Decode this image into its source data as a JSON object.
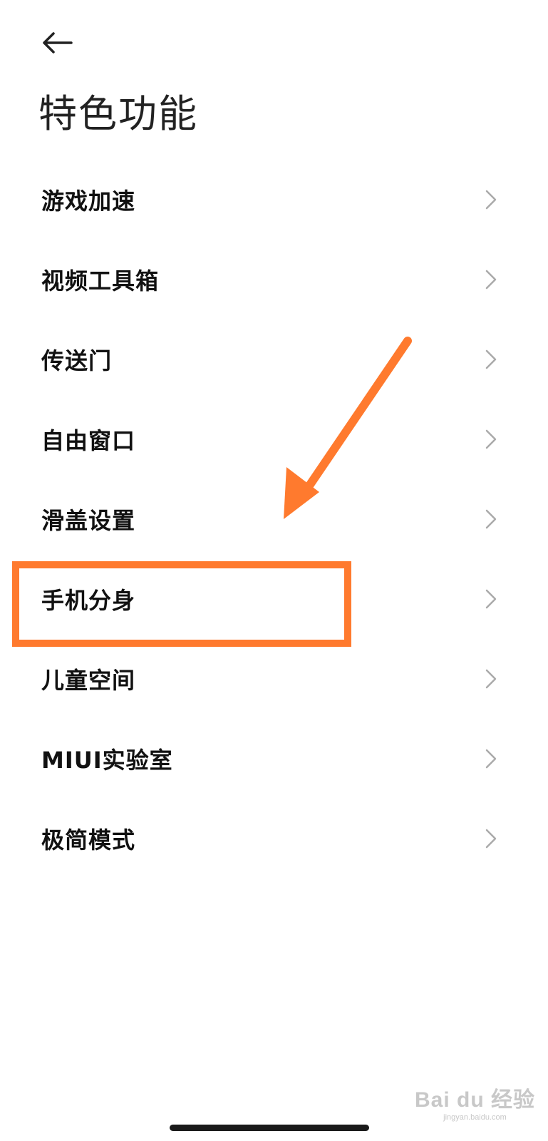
{
  "header": {
    "back_icon": "arrow-left-icon",
    "title": "特色功能"
  },
  "menu": {
    "items": [
      {
        "label": "游戏加速",
        "icon": "chevron-right-icon"
      },
      {
        "label": "视频工具箱",
        "icon": "chevron-right-icon"
      },
      {
        "label": "传送门",
        "icon": "chevron-right-icon"
      },
      {
        "label": "自由窗口",
        "icon": "chevron-right-icon"
      },
      {
        "label": "滑盖设置",
        "icon": "chevron-right-icon"
      },
      {
        "label": "手机分身",
        "icon": "chevron-right-icon"
      },
      {
        "label": "儿童空间",
        "icon": "chevron-right-icon"
      },
      {
        "label": "MIUI实验室",
        "icon": "chevron-right-icon"
      },
      {
        "label": "极简模式",
        "icon": "chevron-right-icon"
      }
    ]
  },
  "annotation": {
    "color": "#FF7A2E",
    "highlighted_item": "手机分身"
  },
  "watermark": {
    "logo": "Bai du 经验",
    "url": "jingyan.baidu.com"
  },
  "colors": {
    "background": "#FFFFFF",
    "text_primary": "#111111",
    "chevron": "#AAAAAA"
  }
}
